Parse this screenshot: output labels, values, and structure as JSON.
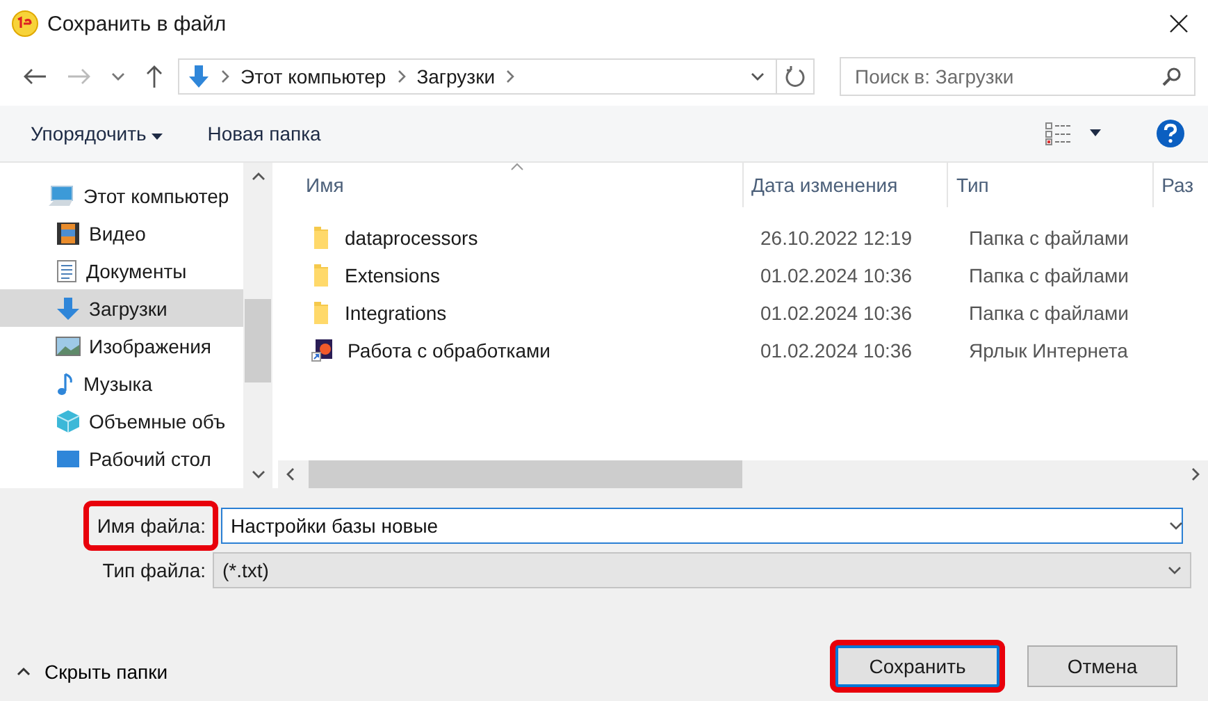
{
  "window": {
    "title": "Сохранить в файл"
  },
  "nav": {
    "breadcrumb": [
      "Этот компьютер",
      "Загрузки"
    ],
    "search_placeholder": "Поиск в: Загрузки"
  },
  "toolbar": {
    "organize": "Упорядочить",
    "new_folder": "Новая папка"
  },
  "sidebar": {
    "items": [
      {
        "label": "Этот компьютер",
        "kind": "computer",
        "selected": false
      },
      {
        "label": "Видео",
        "kind": "video",
        "selected": false
      },
      {
        "label": "Документы",
        "kind": "documents",
        "selected": false
      },
      {
        "label": "Загрузки",
        "kind": "downloads",
        "selected": true
      },
      {
        "label": "Изображения",
        "kind": "pictures",
        "selected": false
      },
      {
        "label": "Музыка",
        "kind": "music",
        "selected": false
      },
      {
        "label": "Объемные объ",
        "kind": "objects3d",
        "selected": false
      },
      {
        "label": "Рабочий стол",
        "kind": "desktop",
        "selected": false
      }
    ]
  },
  "table": {
    "columns": [
      {
        "label": "Имя",
        "sorted": true
      },
      {
        "label": "Дата изменения",
        "sorted": false
      },
      {
        "label": "Тип",
        "sorted": false
      },
      {
        "label": "Раз",
        "sorted": false
      }
    ],
    "rows": [
      {
        "name": "dataprocessors",
        "date": "26.10.2022 12:19",
        "type": "Папка с файлами",
        "kind": "folder"
      },
      {
        "name": "Extensions",
        "date": "01.02.2024 10:36",
        "type": "Папка с файлами",
        "kind": "folder"
      },
      {
        "name": "Integrations",
        "date": "01.02.2024 10:36",
        "type": "Папка с файлами",
        "kind": "folder"
      },
      {
        "name": "Работа с обработками",
        "date": "01.02.2024 10:36",
        "type": "Ярлык Интернета",
        "kind": "shortcut"
      }
    ]
  },
  "form": {
    "filename": {
      "label": "Имя файла:",
      "value": "Настройки базы новые",
      "highlighted": true
    },
    "filetype": {
      "label": "Тип файла:",
      "value": "(*.txt)"
    }
  },
  "hide_folders": "Скрыть папки",
  "buttons": [
    {
      "label": "Сохранить",
      "kind": "primary",
      "highlighted": true
    },
    {
      "label": "Отмена",
      "kind": "secondary",
      "highlighted": false
    }
  ]
}
